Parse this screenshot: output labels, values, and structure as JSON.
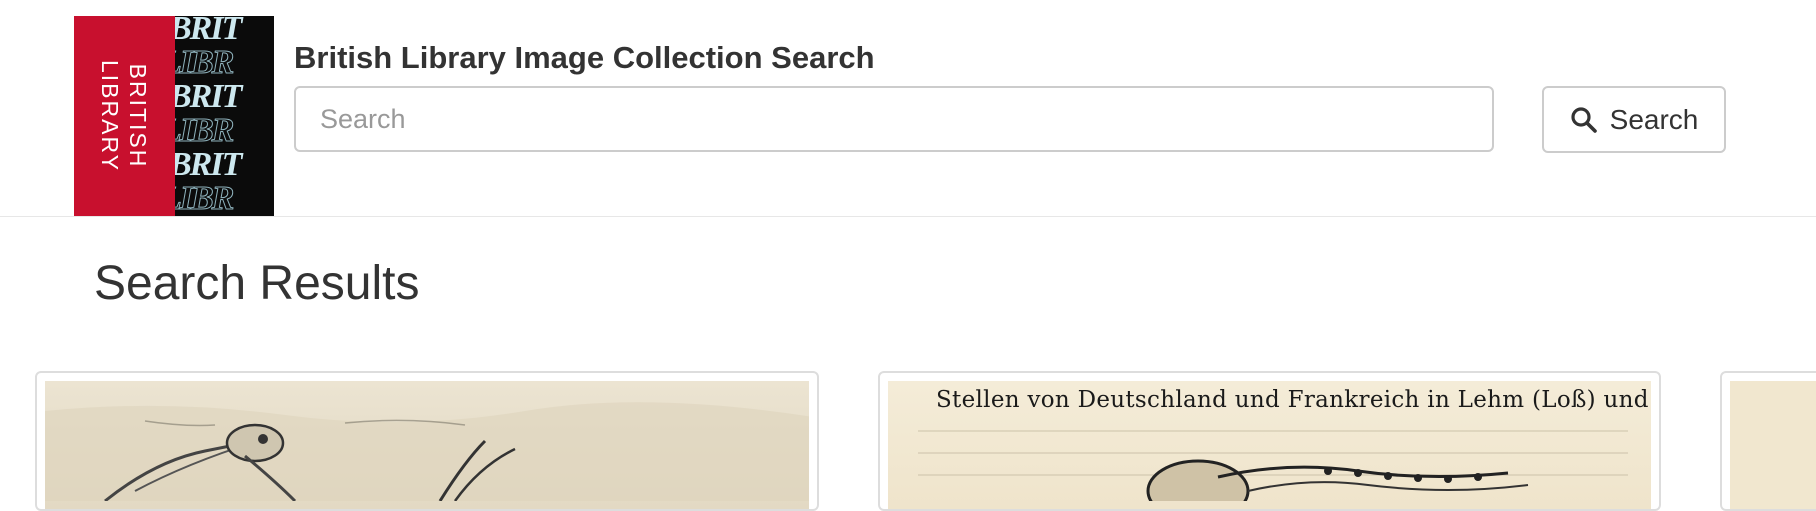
{
  "header": {
    "logo": {
      "red_line1": "BRITISH",
      "red_line2": "LIBRARY",
      "pattern_rows": [
        "BRIT",
        "LIBR",
        "BRIT",
        "LIBR",
        "BRIT",
        "LIBR"
      ],
      "colors": {
        "red": "#c8102e",
        "black": "#0b0b0b",
        "pale_blue": "#cde8ef"
      }
    },
    "title": "British Library Image Collection Search",
    "search": {
      "placeholder": "Search",
      "value": ""
    },
    "search_button": {
      "label": "Search",
      "icon": "search-icon"
    }
  },
  "main": {
    "heading": "Search Results",
    "results": [
      {
        "kind": "illustration-birds"
      },
      {
        "kind": "illustration-page",
        "visible_text": "Stellen von Deutschland und Frankreich in Lehm (Loß) und Fluß="
      },
      {
        "kind": "illustration-partial"
      }
    ]
  }
}
